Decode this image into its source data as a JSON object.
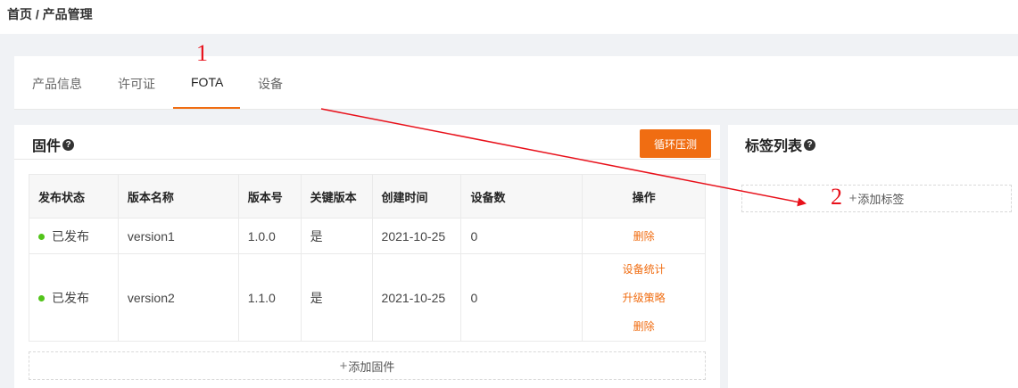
{
  "breadcrumb": {
    "home": "首页",
    "sep": "/",
    "current": "产品管理"
  },
  "tabs": [
    {
      "label": "产品信息"
    },
    {
      "label": "许可证"
    },
    {
      "label": "FOTA"
    },
    {
      "label": "设备"
    }
  ],
  "firmware": {
    "title": "固件",
    "help": "?",
    "loop_test_button": "循环压测",
    "columns": [
      "发布状态",
      "版本名称",
      "版本号",
      "关键版本",
      "创建时间",
      "设备数",
      "操作"
    ],
    "rows": [
      {
        "status": "已发布",
        "name": "version1",
        "version": "1.0.0",
        "key_version": "是",
        "created": "2021-10-25",
        "devices": "0",
        "ops": [
          "删除"
        ]
      },
      {
        "status": "已发布",
        "name": "version2",
        "version": "1.1.0",
        "key_version": "是",
        "created": "2021-10-25",
        "devices": "0",
        "ops": [
          "设备统计",
          "升级策略",
          "删除"
        ]
      }
    ],
    "status_color": "#52c41a",
    "add_label": "添加固件",
    "plus": "+"
  },
  "tag_list": {
    "title": "标签列表",
    "help": "?",
    "add_label": "添加标签",
    "plus": "+"
  },
  "annotations": {
    "one": "1",
    "two": "2",
    "color": "#e8101a"
  },
  "accent_color": "#f06d12"
}
